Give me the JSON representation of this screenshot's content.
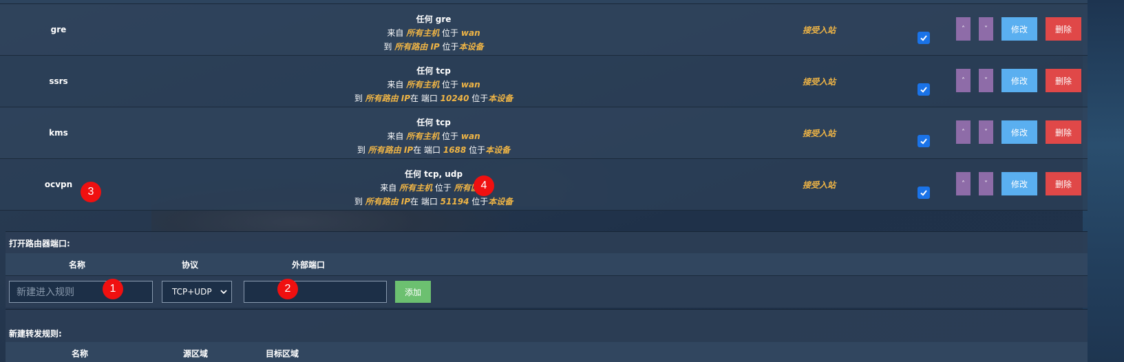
{
  "rules": [
    {
      "name": "gre",
      "line1": "任何 gre",
      "line2_prefix": "来自",
      "line2_src": "所有主机",
      "line2_mid": "位于",
      "line2_zone": "wan",
      "line3_prefix": "到",
      "line3_dst": "所有路由 IP",
      "line3_port_prefix": "",
      "line3_port": "",
      "line3_mid": "位于",
      "line3_dev": "本设备",
      "action": "接受入站",
      "enabled": true
    },
    {
      "name": "ssrs",
      "line1": "任何 tcp",
      "line2_prefix": "来自",
      "line2_src": "所有主机",
      "line2_mid": "位于",
      "line2_zone": "wan",
      "line3_prefix": "到",
      "line3_dst": "所有路由 IP",
      "line3_port_prefix": "在 端口",
      "line3_port": "10240",
      "line3_mid": "位于",
      "line3_dev": "本设备",
      "action": "接受入站",
      "enabled": true
    },
    {
      "name": "kms",
      "line1": "任何 tcp",
      "line2_prefix": "来自",
      "line2_src": "所有主机",
      "line2_mid": "位于",
      "line2_zone": "wan",
      "line3_prefix": "到",
      "line3_dst": "所有路由 IP",
      "line3_port_prefix": "在 端口",
      "line3_port": "1688",
      "line3_mid": "位于",
      "line3_dev": "本设备",
      "action": "接受入站",
      "enabled": true
    },
    {
      "name": "ocvpn",
      "line1": "任何 tcp, udp",
      "line2_prefix": "来自",
      "line2_src": "所有主机",
      "line2_mid": "位于",
      "line2_zone": "所有区域",
      "line3_prefix": "到",
      "line3_dst": "所有路由 IP",
      "line3_port_prefix": "在 端口",
      "line3_port": "51194",
      "line3_mid": "位于",
      "line3_dev": "本设备",
      "action": "接受入站",
      "enabled": true
    }
  ],
  "buttons": {
    "up": "˄",
    "down": "˅",
    "edit": "修改",
    "delete": "删除",
    "add": "添加"
  },
  "open_ports": {
    "title": "打开路由器端口:",
    "col_name": "名称",
    "col_proto": "协议",
    "col_ext_port": "外部端口",
    "name_placeholder": "新建进入规则",
    "proto_value": "TCP+UDP",
    "ext_port_value": ""
  },
  "forward": {
    "title": "新建转发规则:",
    "col_name": "名称",
    "col_src_zone": "源区域",
    "col_dst_zone": "目标区域"
  },
  "markers": [
    "1",
    "2",
    "3",
    "4"
  ],
  "colors": {
    "highlight": "#f0b545",
    "edit": "#5aaff0",
    "delete": "#e04848",
    "move": "#8e6ca8",
    "add": "#6cc070",
    "marker": "#f01010"
  },
  "icons": {
    "checkbox": "checkmark-icon",
    "select": "chevron-down-icon"
  }
}
